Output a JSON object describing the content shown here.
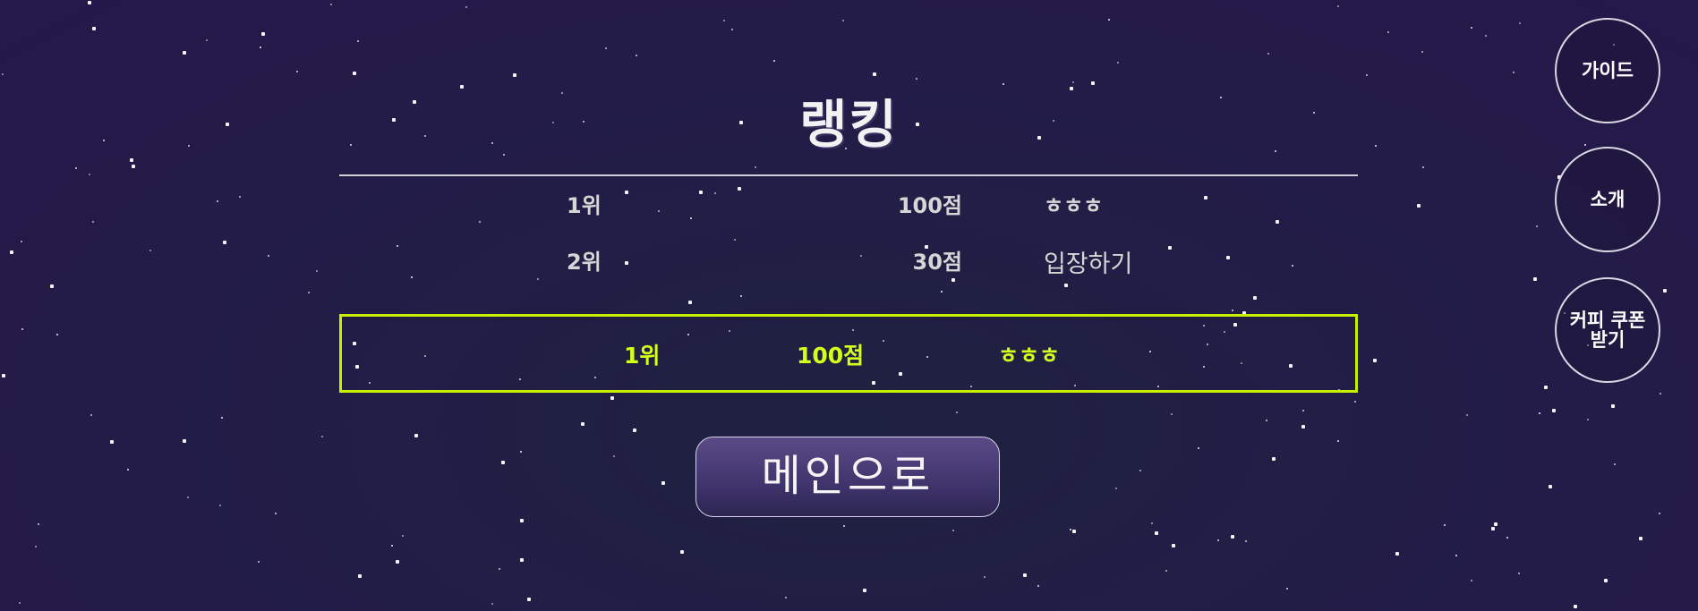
{
  "ranking": {
    "title": "랭킹",
    "rows": [
      {
        "rank": "1위",
        "score": "100점",
        "name": "ㅎㅎㅎ"
      },
      {
        "rank": "2위",
        "score": "30점",
        "name": "입장하기"
      }
    ]
  },
  "my_rank": {
    "rank": "1위",
    "score": "100점",
    "name": "ㅎㅎㅎ",
    "highlight_color": "#c6f000"
  },
  "main_button_label": "메인으로",
  "side_menu": {
    "guide": "가이드",
    "intro": "소개",
    "coupon_line1": "커피 쿠폰",
    "coupon_line2": "받기"
  }
}
